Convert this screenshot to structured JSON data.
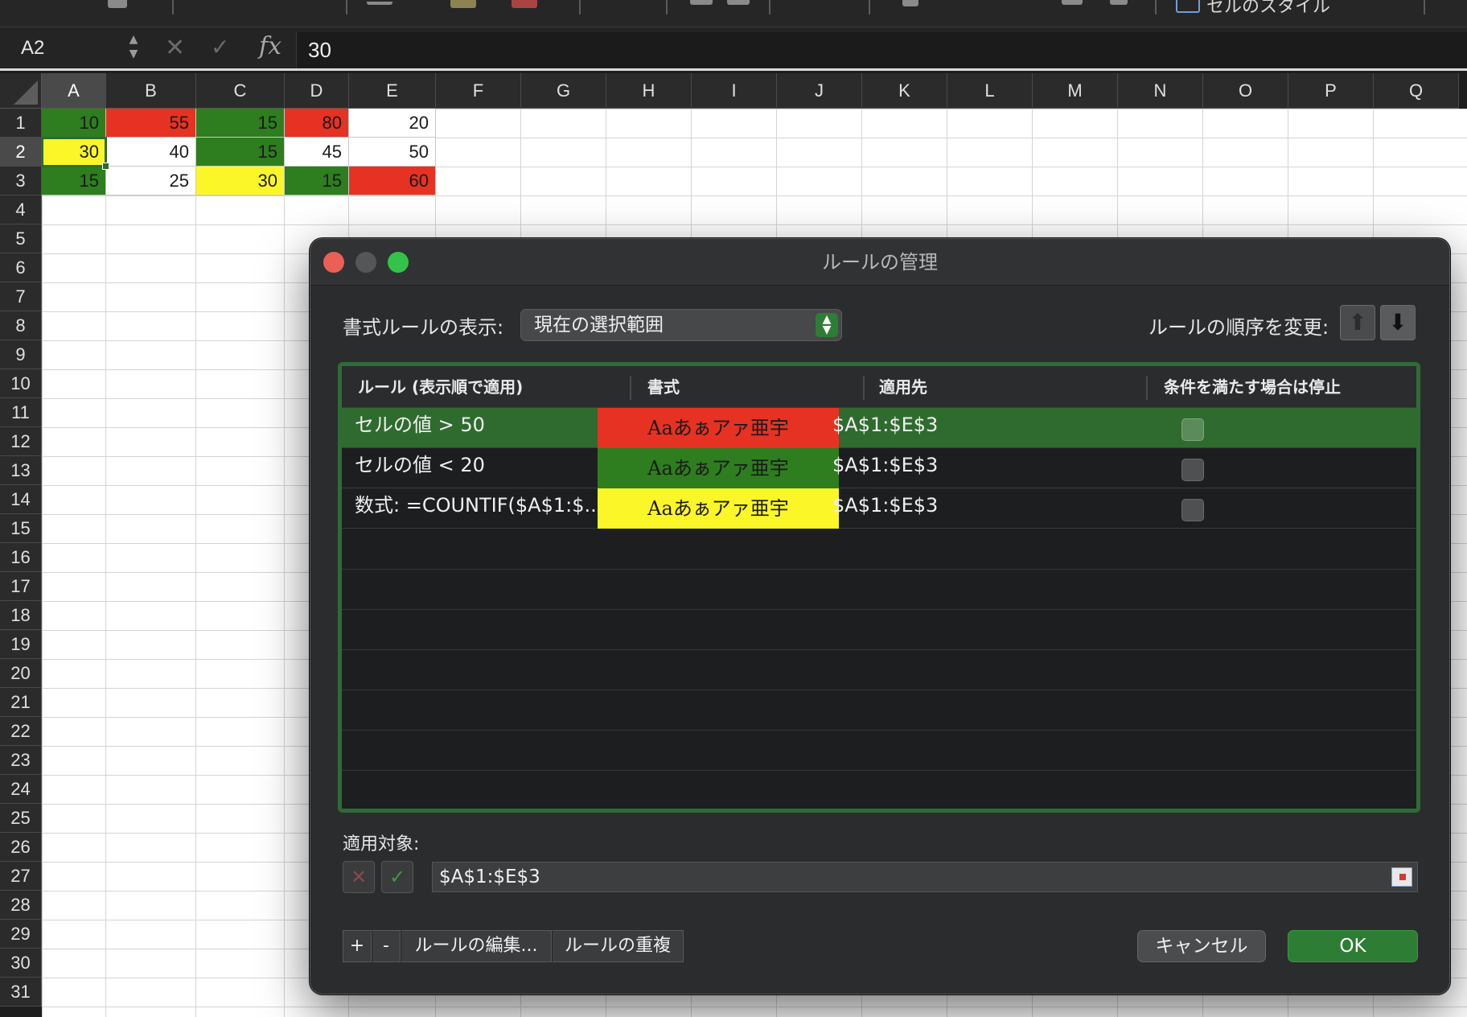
{
  "toolbar": {
    "cell_styles_label": "セルのスタイル"
  },
  "formula_bar": {
    "name_box": "A2",
    "cancel_glyph": "✕",
    "enter_glyph": "✓",
    "fx_label": "fx",
    "value": "30"
  },
  "grid": {
    "columns": [
      "A",
      "B",
      "C",
      "D",
      "E",
      "F",
      "G",
      "H",
      "I",
      "J",
      "K",
      "L",
      "M",
      "N",
      "O",
      "P",
      "Q"
    ],
    "rows": [
      "1",
      "2",
      "3",
      "4",
      "5",
      "6",
      "7",
      "8",
      "9",
      "10",
      "11",
      "12",
      "13",
      "14",
      "15",
      "16",
      "17",
      "18",
      "19",
      "20",
      "21",
      "22",
      "23",
      "24",
      "25",
      "26",
      "27",
      "28",
      "29",
      "30",
      "31"
    ],
    "active_cell": "A2",
    "cells": [
      {
        "ref": "A1",
        "value": "10",
        "fill": "#2e7d1e"
      },
      {
        "ref": "B1",
        "value": "55",
        "fill": "#e53223"
      },
      {
        "ref": "C1",
        "value": "15",
        "fill": "#2e7d1e"
      },
      {
        "ref": "D1",
        "value": "80",
        "fill": "#e53223"
      },
      {
        "ref": "E1",
        "value": "20",
        "fill": "#ffffff"
      },
      {
        "ref": "A2",
        "value": "30",
        "fill": "#fbf628"
      },
      {
        "ref": "B2",
        "value": "40",
        "fill": "#ffffff"
      },
      {
        "ref": "C2",
        "value": "15",
        "fill": "#2e7d1e"
      },
      {
        "ref": "D2",
        "value": "45",
        "fill": "#ffffff"
      },
      {
        "ref": "E2",
        "value": "50",
        "fill": "#ffffff"
      },
      {
        "ref": "A3",
        "value": "15",
        "fill": "#2e7d1e"
      },
      {
        "ref": "B3",
        "value": "25",
        "fill": "#ffffff"
      },
      {
        "ref": "C3",
        "value": "30",
        "fill": "#fbf628"
      },
      {
        "ref": "D3",
        "value": "15",
        "fill": "#2e7d1e"
      },
      {
        "ref": "E3",
        "value": "60",
        "fill": "#e53223"
      }
    ]
  },
  "dialog": {
    "title": "ルールの管理",
    "show_rules_label": "書式ルールの表示:",
    "show_rules_value": "現在の選択範囲",
    "change_order_label": "ルールの順序を変更:",
    "move_up_glyph": "⬆",
    "move_down_glyph": "⬇",
    "table": {
      "headers": [
        "ルール (表示順で適用)",
        "書式",
        "適用先",
        "条件を満たす場合は停止"
      ],
      "rows": [
        {
          "rule": "セルの値 > 50",
          "format_sample": "Aaあぁアァ亜宇",
          "format_fill": "#e53223",
          "applies_to": "$A$1:$E$3",
          "stop_if_true": false,
          "selected": true
        },
        {
          "rule": "セルの値 < 20",
          "format_sample": "Aaあぁアァ亜宇",
          "format_fill": "#2e7d1e",
          "applies_to": "$A$1:$E$3",
          "stop_if_true": false,
          "selected": false
        },
        {
          "rule": "数式: =COUNTIF($A$1:$...",
          "format_sample": "Aaあぁアァ亜宇",
          "format_fill": "#fbf628",
          "applies_to": "$A$1:$E$3",
          "stop_if_true": false,
          "selected": false
        }
      ]
    },
    "applies_to_label": "適用対象:",
    "applies_to_value": "$A$1:$E$3",
    "add_button": "+",
    "remove_button": "-",
    "edit_rule_button": "ルールの編集...",
    "duplicate_rule_button": "ルールの重複",
    "cancel_button": "キャンセル",
    "ok_button": "OK"
  },
  "colors": {
    "accent_green": "#2e7d34",
    "rule_red": "#e53223",
    "rule_green": "#2e7d1e",
    "rule_yellow": "#fbf628"
  }
}
